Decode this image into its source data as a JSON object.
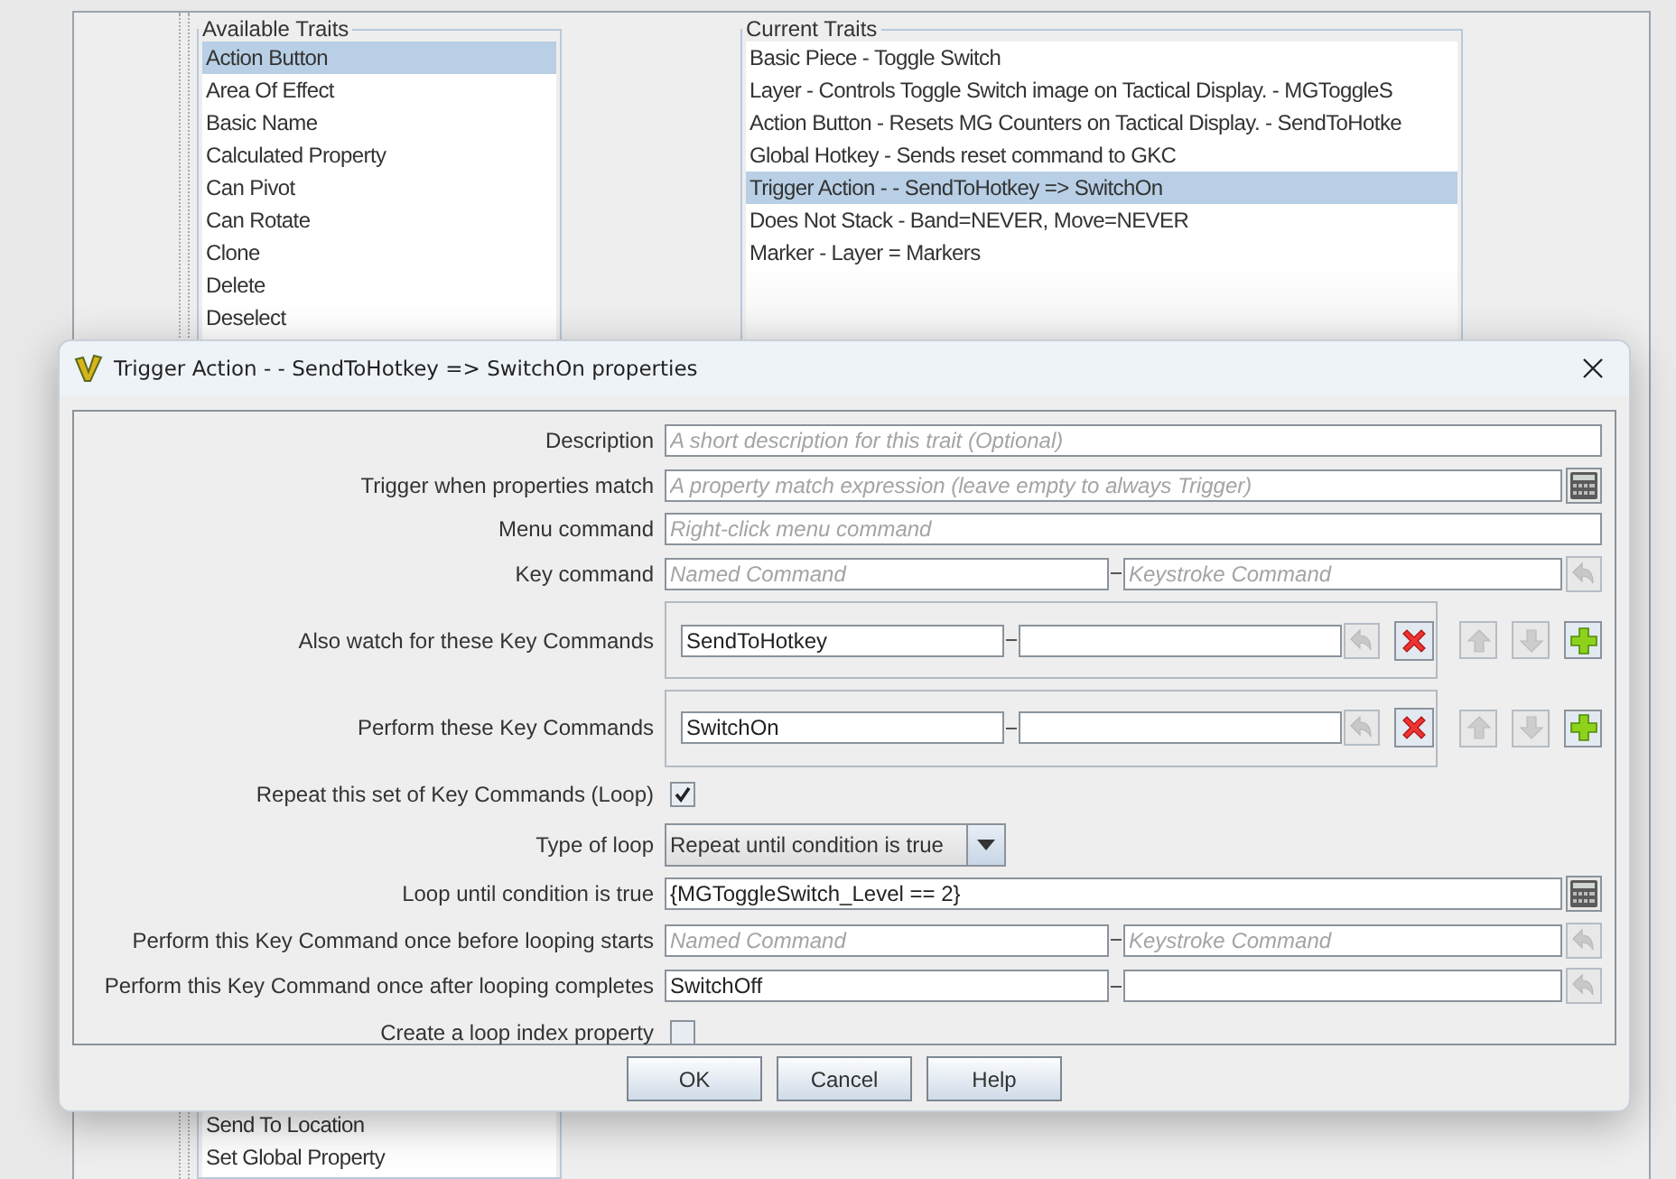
{
  "traits_editor": {
    "available_traits": {
      "title": "Available Traits",
      "items": [
        {
          "label": "Action Button",
          "selected": true
        },
        {
          "label": "Area Of Effect",
          "selected": false
        },
        {
          "label": "Basic Name",
          "selected": false
        },
        {
          "label": "Calculated Property",
          "selected": false
        },
        {
          "label": "Can Pivot",
          "selected": false
        },
        {
          "label": "Can Rotate",
          "selected": false
        },
        {
          "label": "Clone",
          "selected": false
        },
        {
          "label": "Delete",
          "selected": false
        },
        {
          "label": "Deselect",
          "selected": false
        }
      ],
      "items_below_dialog": [
        {
          "label": "Send To Location",
          "selected": false
        },
        {
          "label": "Set Global Property",
          "selected": false
        }
      ]
    },
    "current_traits": {
      "title": "Current Traits",
      "items": [
        {
          "label": "Basic Piece - Toggle Switch",
          "selected": false
        },
        {
          "label": "Layer - Controls Toggle Switch image on Tactical Display. - MGToggleS",
          "selected": false
        },
        {
          "label": "Action Button - Resets MG Counters on Tactical Display. - SendToHotke",
          "selected": false
        },
        {
          "label": "Global Hotkey - Sends reset command to GKC",
          "selected": false
        },
        {
          "label": "Trigger Action -  - SendToHotkey => SwitchOn",
          "selected": true
        },
        {
          "label": "Does Not Stack - Band=NEVER, Move=NEVER",
          "selected": false
        },
        {
          "label": "Marker - Layer = Markers",
          "selected": false
        }
      ]
    }
  },
  "dialog": {
    "title": "Trigger Action -  - SendToHotkey => SwitchOn properties",
    "rows": [
      {
        "kind": "text",
        "label": "Description",
        "placeholder": "A short description for this trait (Optional)"
      },
      {
        "kind": "expression",
        "label": "Trigger when properties match",
        "placeholder": "A property match expression (leave empty to always Trigger)"
      },
      {
        "kind": "text",
        "label": "Menu command",
        "placeholder": "Right-click menu command"
      },
      {
        "kind": "keystroke",
        "label": "Key command",
        "name": {
          "placeholder": "Named Command"
        },
        "keystroke": {
          "placeholder": "Keystroke Command"
        }
      },
      {
        "kind": "command_list",
        "label": "Also watch for these Key Commands",
        "entries": [
          {
            "name": "SendToHotkey"
          }
        ]
      },
      {
        "kind": "command_list",
        "label": "Perform these Key Commands",
        "entries": [
          {
            "name": "SwitchOn"
          }
        ]
      },
      {
        "kind": "checkbox",
        "label": "Repeat this set of Key Commands (Loop)",
        "checked": true
      },
      {
        "kind": "dropdown",
        "label": "Type of loop",
        "value": "Repeat until condition is true"
      },
      {
        "kind": "expression",
        "label": "Loop until condition is true",
        "value": "{MGToggleSwitch_Level == 2}"
      },
      {
        "kind": "keystroke",
        "label": "Perform this Key Command once before looping starts",
        "name": {
          "placeholder": "Named Command"
        },
        "keystroke": {
          "placeholder": "Keystroke Command"
        }
      },
      {
        "kind": "keystroke",
        "label": "Perform this Key Command once after looping completes",
        "name": {
          "value": "SwitchOff"
        },
        "keystroke": {}
      },
      {
        "kind": "checkbox",
        "label": "Create a loop index property",
        "checked": false
      }
    ],
    "buttons": [
      "OK",
      "Cancel",
      "Help"
    ]
  }
}
